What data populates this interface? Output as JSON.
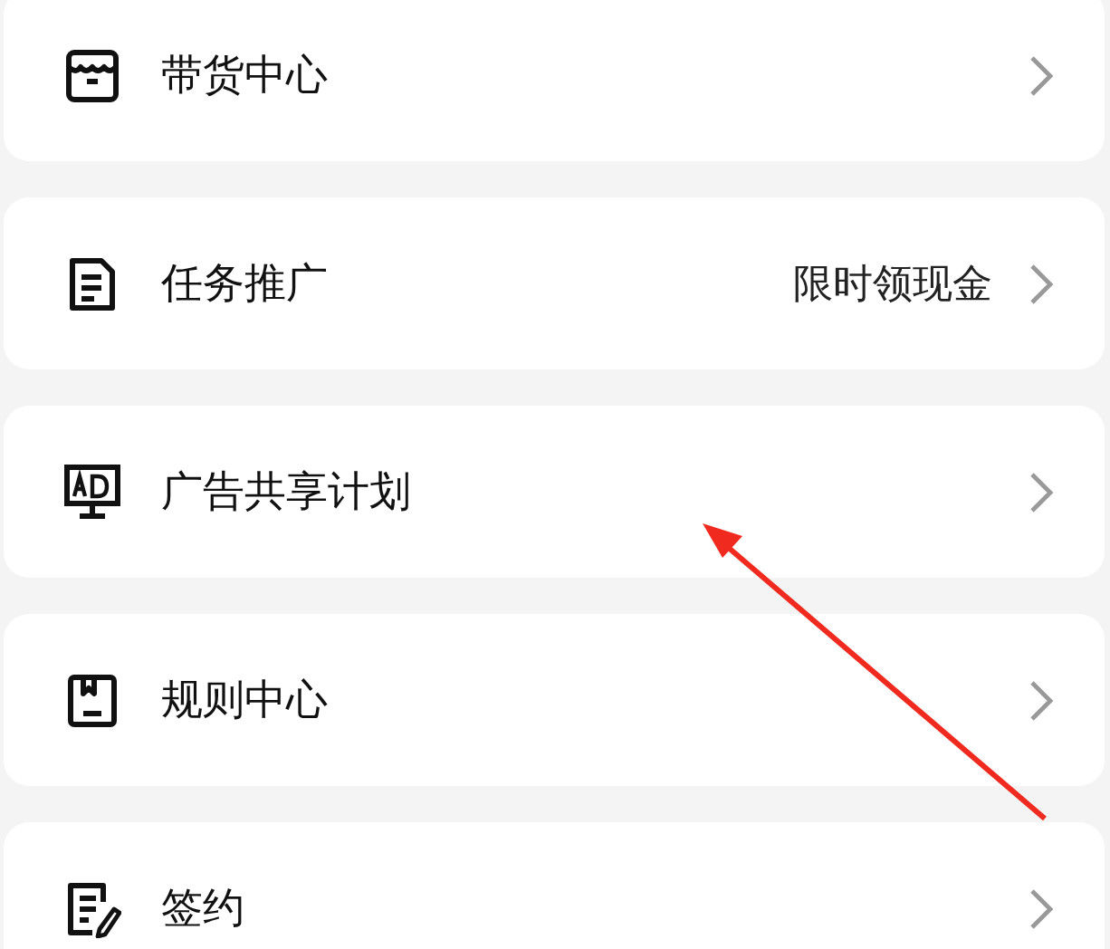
{
  "menu": {
    "items": [
      {
        "label": "带货中心"
      },
      {
        "label": "任务推广",
        "note": "限时领现金"
      },
      {
        "label": "广告共享计划"
      },
      {
        "label": "规则中心"
      },
      {
        "label": "签约"
      }
    ]
  }
}
